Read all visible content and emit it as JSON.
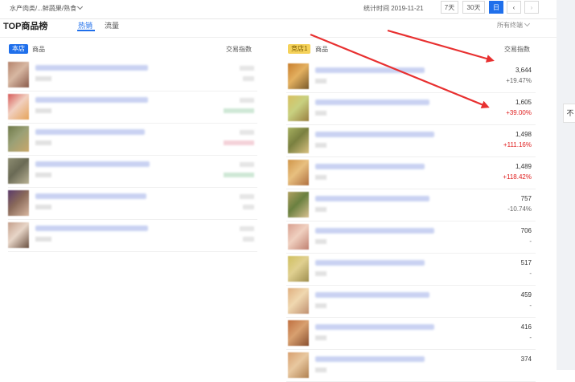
{
  "header": {
    "breadcrumb": "水产肉类/...鲜蔬果/熟食",
    "stat_time": "统计时间 2019-11-21",
    "buttons": [
      "7天",
      "30天",
      "日"
    ],
    "prev": "‹",
    "next": "›"
  },
  "board": {
    "title": "TOP商品榜",
    "tabs": [
      "热销",
      "流量"
    ],
    "channel": "所有终端"
  },
  "own": {
    "badge": "本店",
    "col_product": "商品",
    "col_index": "交易指数",
    "rows": [
      {
        "thumb": [
          "#b5836c",
          "#8a5a4a",
          "#d7b7a2"
        ],
        "name_w": 140,
        "val_style": "",
        "chg_style": ""
      },
      {
        "thumb": [
          "#d65a5a",
          "#e5a35a",
          "#f1d0c0"
        ],
        "name_w": 140,
        "val_style": "",
        "chg_style": "green"
      },
      {
        "thumb": [
          "#6f7a4a",
          "#c9a76a",
          "#9aa076"
        ],
        "name_w": 136,
        "val_style": "",
        "chg_style": "pink"
      },
      {
        "thumb": [
          "#8c8c70",
          "#b9b295",
          "#6a6a55"
        ],
        "name_w": 142,
        "val_style": "",
        "chg_style": "green"
      },
      {
        "thumb": [
          "#5a3a6a",
          "#d8b7a0",
          "#8a6a5a"
        ],
        "name_w": 138,
        "val_style": "",
        "chg_style": ""
      },
      {
        "thumb": [
          "#c4a08c",
          "#6a5040",
          "#e8d6c8"
        ],
        "name_w": 140,
        "val_style": "",
        "chg_style": ""
      }
    ]
  },
  "rival": {
    "badge": "竞店1",
    "col_product": "商品",
    "col_index": "交易指数",
    "rows": [
      {
        "value": "3,644",
        "change": "+19.47%",
        "dir": "neutral",
        "thumb": [
          "#c97f2c",
          "#7a5a2a",
          "#e3b060"
        ]
      },
      {
        "value": "1,605",
        "change": "+39.00%",
        "dir": "up",
        "thumb": [
          "#d8c060",
          "#9a8040",
          "#c8d080"
        ]
      },
      {
        "value": "1,498",
        "change": "+111.16%",
        "dir": "up",
        "thumb": [
          "#a6b060",
          "#d8c080",
          "#7a8040"
        ]
      },
      {
        "value": "1,489",
        "change": "+118.42%",
        "dir": "up",
        "thumb": [
          "#d0964a",
          "#b07040",
          "#e8c080"
        ]
      },
      {
        "value": "757",
        "change": "-10.74%",
        "dir": "neutral",
        "thumb": [
          "#b0a060",
          "#d8c090",
          "#6a8040"
        ]
      },
      {
        "value": "706",
        "change": "-",
        "dir": "neutral",
        "thumb": [
          "#d8a090",
          "#c08070",
          "#f0d0c0"
        ]
      },
      {
        "value": "517",
        "change": "-",
        "dir": "neutral",
        "thumb": [
          "#d0c060",
          "#a09050",
          "#e0d090"
        ]
      },
      {
        "value": "459",
        "change": "-",
        "dir": "neutral",
        "thumb": [
          "#e0b080",
          "#c09070",
          "#f0d8b0"
        ]
      },
      {
        "value": "416",
        "change": "-",
        "dir": "neutral",
        "thumb": [
          "#c07040",
          "#8a5030",
          "#d8a070"
        ]
      },
      {
        "value": "374",
        "change": "",
        "dir": "neutral",
        "thumb": [
          "#d8a070",
          "#b08050",
          "#e8c8a0"
        ]
      }
    ]
  },
  "side_button": "不",
  "colors": {
    "accent": "#1f6feb",
    "up": "#e02020",
    "arrow": "#e83030"
  }
}
